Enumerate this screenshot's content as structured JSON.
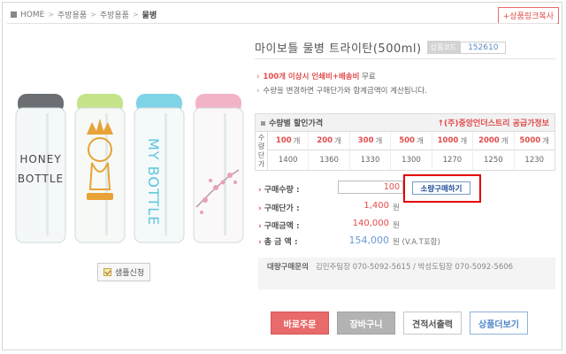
{
  "breadcrumb": {
    "home": "HOME",
    "items": [
      "주방용품",
      "주방용품"
    ],
    "current": "물병"
  },
  "link_copy_label": "+상품링크복사",
  "product": {
    "title": "마이보틀 물병 트라이탄(500ml)",
    "code_label": "상품코드",
    "code_value": "152610",
    "bottles": [
      {
        "cap_color": "#6b6f73",
        "text": "HONEY BOTTLE",
        "text_color": "#4a4a4a"
      },
      {
        "cap_color": "#c5e48a",
        "text": "",
        "text_color": "#e8a236"
      },
      {
        "cap_color": "#7fd3e6",
        "text": "MY BOTTLE",
        "text_color": "#5bc6dc"
      },
      {
        "cap_color": "#f3b3c6",
        "text": "",
        "text_color": "#e7a1b8"
      }
    ]
  },
  "sample_button_label": "샘플신청",
  "notice": {
    "line1_prefix": "100개 이상시 ",
    "line1_red": "인쇄비+배송비",
    "line1_suffix": " 무료",
    "line2": "수량을 변경하면 구매단가와 합계금액이 계산됩니다."
  },
  "discount_table": {
    "header_left": "수량별 할인가격",
    "header_right": "↑(주)중앙언더스트리 공급가정보",
    "side_label": [
      "수",
      "량",
      "단",
      "가"
    ],
    "unit": "개",
    "quantities": [
      "100",
      "200",
      "300",
      "500",
      "1000",
      "2000",
      "5000"
    ],
    "prices": [
      "1400",
      "1360",
      "1330",
      "1300",
      "1270",
      "1250",
      "1230"
    ]
  },
  "purchase": {
    "qty_label": "구매수량 :",
    "qty_value": "100",
    "bulk_button": "소량구매하기",
    "unit_price_label": "구매단가 :",
    "unit_price": "1,400",
    "price_label": "구매금액 :",
    "price": "140,000",
    "total_label": "총 금 액 :",
    "total": "154,000",
    "won": "원",
    "vat_note": "원 (V.A.T포함)"
  },
  "inquiry": {
    "label": "대량구매문의",
    "text": "김민주팀장 070-5092-5615 / 박성도팀장 070-5092-5606"
  },
  "actions": {
    "order": "바로주문",
    "cart": "장바구니",
    "quote": "견적서출력",
    "more": "상품더보기"
  },
  "colors": {
    "accent_red": "#e24c4c",
    "order_btn": "#e96a6a",
    "highlight_box": "#e30000",
    "link_blue": "#4f86c6"
  }
}
